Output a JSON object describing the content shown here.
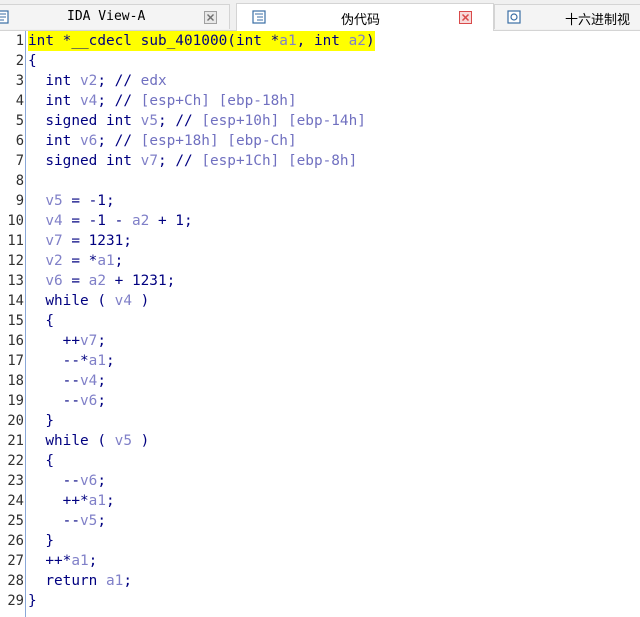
{
  "tabs": [
    {
      "label": "IDA View-A",
      "active": false
    },
    {
      "label": "伪代码",
      "active": true
    },
    {
      "label": "十六进制视",
      "active": false
    }
  ],
  "colors": {
    "highlight": "#ffff00",
    "keyword": "#000080",
    "variable": "#8080c8",
    "comment": "#7070c0",
    "close_icon": "#d94a4a",
    "tab_icon": "#3a6ea5"
  },
  "code_lines": [
    {
      "num": "1",
      "text": "int *__cdecl sub_401000(int *a1, int a2)"
    },
    {
      "num": "2",
      "text": "{"
    },
    {
      "num": "3",
      "text": "  int v2; // edx"
    },
    {
      "num": "4",
      "text": "  int v4; // [esp+Ch] [ebp-18h]"
    },
    {
      "num": "5",
      "text": "  signed int v5; // [esp+10h] [ebp-14h]"
    },
    {
      "num": "6",
      "text": "  int v6; // [esp+18h] [ebp-Ch]"
    },
    {
      "num": "7",
      "text": "  signed int v7; // [esp+1Ch] [ebp-8h]"
    },
    {
      "num": "8",
      "text": ""
    },
    {
      "num": "9",
      "text": "  v5 = -1;"
    },
    {
      "num": "10",
      "text": "  v4 = -1 - a2 + 1;"
    },
    {
      "num": "11",
      "text": "  v7 = 1231;"
    },
    {
      "num": "12",
      "text": "  v2 = *a1;"
    },
    {
      "num": "13",
      "text": "  v6 = a2 + 1231;"
    },
    {
      "num": "14",
      "text": "  while ( v4 )"
    },
    {
      "num": "15",
      "text": "  {"
    },
    {
      "num": "16",
      "text": "    ++v7;"
    },
    {
      "num": "17",
      "text": "    --*a1;"
    },
    {
      "num": "18",
      "text": "    --v4;"
    },
    {
      "num": "19",
      "text": "    --v6;"
    },
    {
      "num": "20",
      "text": "  }"
    },
    {
      "num": "21",
      "text": "  while ( v5 )"
    },
    {
      "num": "22",
      "text": "  {"
    },
    {
      "num": "23",
      "text": "    --v6;"
    },
    {
      "num": "24",
      "text": "    ++*a1;"
    },
    {
      "num": "25",
      "text": "    --v5;"
    },
    {
      "num": "26",
      "text": "  }"
    },
    {
      "num": "27",
      "text": "  ++*a1;"
    },
    {
      "num": "28",
      "text": "  return a1;"
    },
    {
      "num": "29",
      "text": "}"
    }
  ]
}
